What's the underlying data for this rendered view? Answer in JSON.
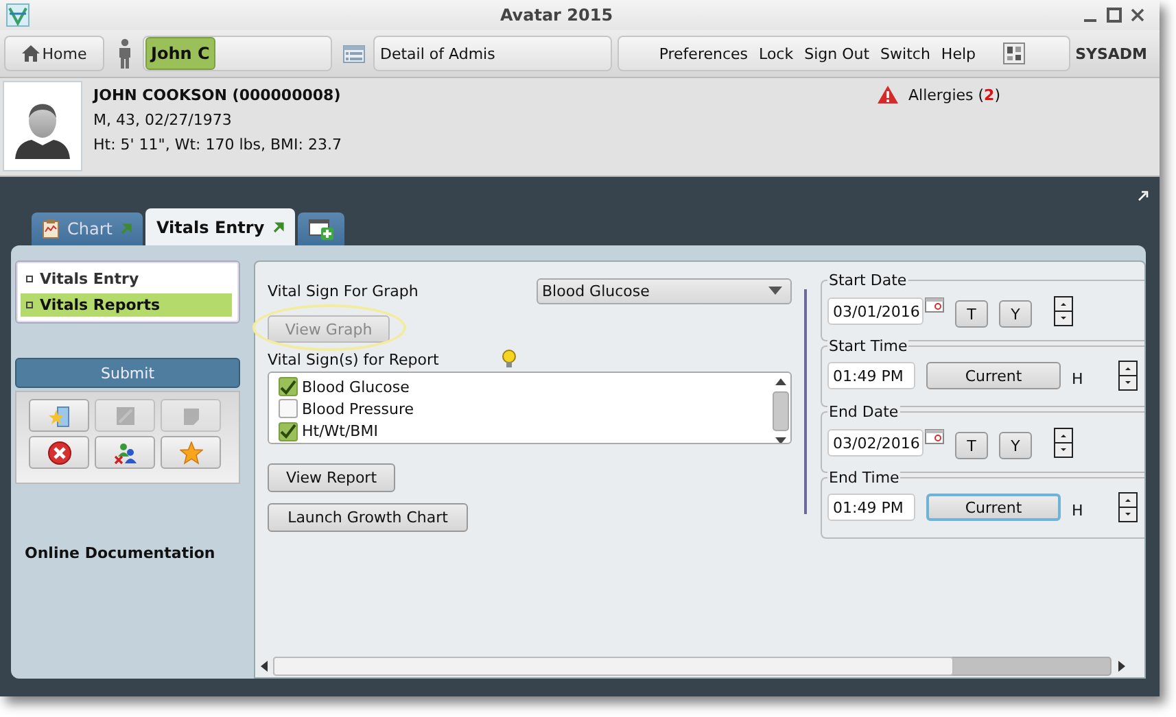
{
  "window": {
    "title": "Avatar 2015"
  },
  "toolbar": {
    "home": "Home",
    "client": "John C",
    "form": "Detail of Admis",
    "menu": [
      "Preferences",
      "Lock",
      "Sign Out",
      "Switch",
      "Help"
    ],
    "user": "SYSADM"
  },
  "patient": {
    "name": "JOHN COOKSON (000000008)",
    "details": "M, 43, 02/27/1973",
    "measurements": "Ht: 5' 11\", Wt: 170 lbs, BMI: 23.7",
    "allergies": {
      "label": "Allergies (",
      "count": "2",
      "suffix": ")"
    }
  },
  "tabs": [
    {
      "label": "Chart",
      "selected": false
    },
    {
      "label": "Vitals Entry",
      "selected": true
    }
  ],
  "sidebar": {
    "items": [
      {
        "label": "Vitals Entry",
        "selected": false
      },
      {
        "label": "Vitals Reports",
        "selected": true
      }
    ],
    "submit": "Submit",
    "tools": [
      {
        "kind": "new",
        "disabled": false
      },
      {
        "kind": "edit",
        "disabled": true
      },
      {
        "kind": "note",
        "disabled": true
      },
      {
        "kind": "delete",
        "disabled": false
      },
      {
        "kind": "people",
        "disabled": false
      },
      {
        "kind": "star",
        "disabled": false
      }
    ],
    "link": "Online Documentation"
  },
  "form": {
    "graph_label": "Vital Sign For Graph",
    "graph_select": "Blood Glucose",
    "view_graph": {
      "label": "View Graph",
      "disabled": true
    },
    "report_label": "Vital Sign(s) for Report",
    "report_items": [
      {
        "label": "Blood Glucose",
        "checked": true
      },
      {
        "label": "Blood Pressure",
        "checked": false
      },
      {
        "label": "Ht/Wt/BMI",
        "checked": true
      }
    ],
    "view_report": "View Report",
    "growth_chart": "Launch Growth Chart"
  },
  "range": [
    {
      "kind": "date",
      "title": "Start Date",
      "value": "03/01/2016",
      "buttons": [
        "T",
        "Y"
      ]
    },
    {
      "kind": "time",
      "title": "Start Time",
      "value": "01:49 PM",
      "button": "Current",
      "focused": false,
      "unit": "H"
    },
    {
      "kind": "date",
      "title": "End Date",
      "value": "03/02/2016",
      "buttons": [
        "T",
        "Y"
      ]
    },
    {
      "kind": "time",
      "title": "End Time",
      "value": "01:49 PM",
      "button": "Current",
      "focused": true,
      "unit": "H"
    }
  ]
}
